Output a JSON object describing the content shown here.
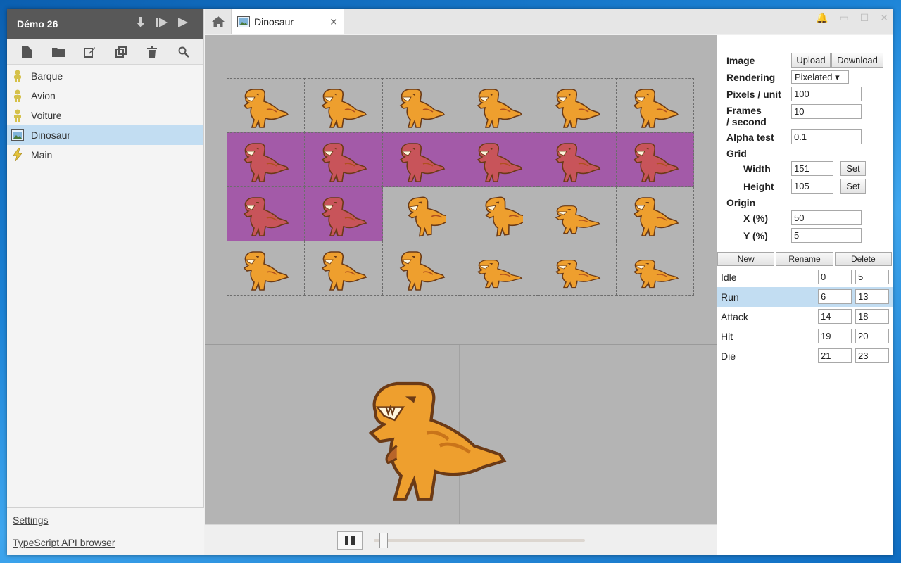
{
  "project": {
    "title": "Démo 26",
    "header_icons": [
      "download-icon",
      "step-play-icon",
      "play-icon"
    ]
  },
  "toolbar_icons": [
    "new-file-icon",
    "folder-icon",
    "rename-icon",
    "duplicate-icon",
    "trash-icon",
    "search-icon"
  ],
  "tree": [
    {
      "label": "Barque",
      "icon": "actor-icon"
    },
    {
      "label": "Avion",
      "icon": "actor-icon"
    },
    {
      "label": "Voiture",
      "icon": "actor-icon"
    },
    {
      "label": "Dinosaur",
      "icon": "sprite-icon",
      "selected": true
    },
    {
      "label": "Main",
      "icon": "script-icon"
    }
  ],
  "footer": {
    "settings": "Settings",
    "api_browser": "TypeScript API browser"
  },
  "tab": {
    "label": "Dinosaur",
    "close": "✕"
  },
  "window_controls": [
    "🔔",
    "▭",
    "☐",
    "✕"
  ],
  "props": {
    "image_label": "Image",
    "upload_label": "Upload",
    "download_label": "Download",
    "rendering_label": "Rendering",
    "rendering_value": "Pixelated ▾",
    "pixels_label": "Pixels / unit",
    "pixels_value": "100",
    "frames_label_1": "Frames",
    "frames_label_2": "/ second",
    "frames_value": "10",
    "alpha_label": "Alpha test",
    "alpha_value": "0.1",
    "grid_label": "Grid",
    "width_label": "Width",
    "width_value": "151",
    "height_label": "Height",
    "height_value": "105",
    "set_label": "Set",
    "origin_label": "Origin",
    "x_label": "X (%)",
    "x_value": "50",
    "y_label": "Y (%)",
    "y_value": "5"
  },
  "anim_buttons": {
    "new": "New",
    "rename": "Rename",
    "delete": "Delete"
  },
  "animations": [
    {
      "name": "Idle",
      "start": "0",
      "end": "5"
    },
    {
      "name": "Run",
      "start": "6",
      "end": "13",
      "selected": true
    },
    {
      "name": "Attack",
      "start": "14",
      "end": "18"
    },
    {
      "name": "Hit",
      "start": "19",
      "end": "20"
    },
    {
      "name": "Die",
      "start": "21",
      "end": "23"
    }
  ],
  "sprite_sheet": {
    "columns": 6,
    "rows": 4,
    "highlighted_frames": [
      6,
      7,
      8,
      9,
      10,
      11,
      12,
      13
    ]
  },
  "colors": {
    "dino_body": "#ee9f2e",
    "dino_outline": "#6b3a16",
    "highlight": "#a35aa8",
    "selection": "#c2ddf2"
  },
  "playback": {
    "state": "playing",
    "position": 0.05
  }
}
